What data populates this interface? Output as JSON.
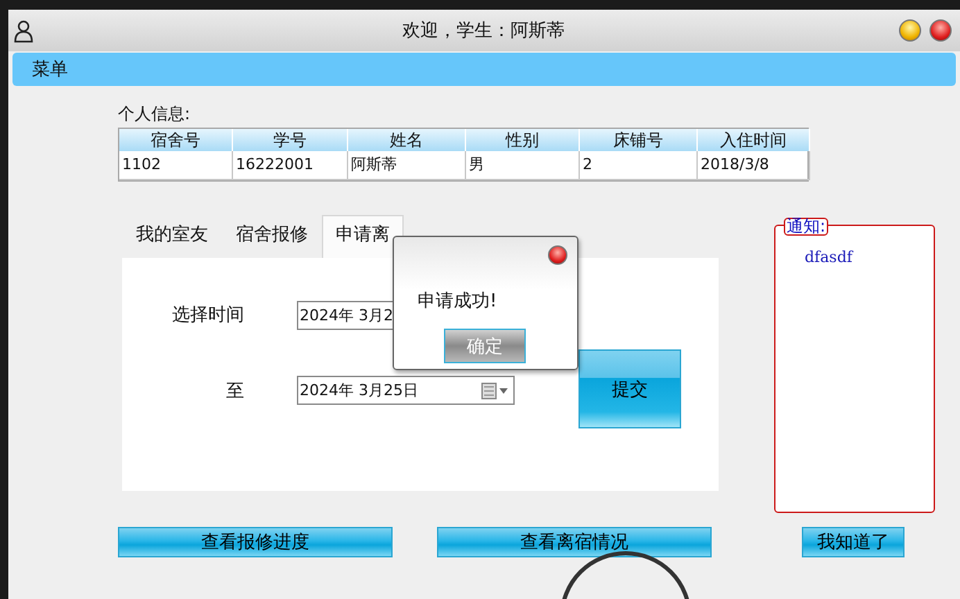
{
  "window": {
    "title": "欢迎，学生：阿斯蒂"
  },
  "menu": {
    "label": "菜单"
  },
  "personal_info": {
    "label": "个人信息:",
    "columns": [
      "宿舍号",
      "学号",
      "姓名",
      "性别",
      "床铺号",
      "入住时间"
    ],
    "rows": [
      [
        "1102",
        "16222001",
        "阿斯蒂",
        "男",
        "2",
        "2018/3/8"
      ]
    ]
  },
  "tabs": [
    {
      "label": "我的室友",
      "selected": false
    },
    {
      "label": "宿舍报修",
      "selected": false
    },
    {
      "label": "申请离",
      "selected": true
    }
  ],
  "form": {
    "fields": [
      {
        "label": "选择时间",
        "value": "2024年 3月2"
      },
      {
        "label": "至",
        "value": "2024年 3月25日"
      }
    ],
    "submit": "提交"
  },
  "notice": {
    "title": "通知:",
    "text": "dfasdf",
    "button": "我知道了"
  },
  "bottom_buttons": [
    "查看报修进度",
    "查看离宿情况"
  ],
  "dialog": {
    "message": "申请成功!",
    "button": "确定"
  }
}
